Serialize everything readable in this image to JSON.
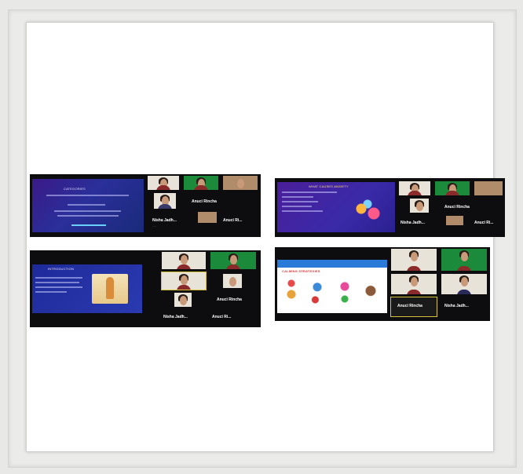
{
  "screenshots": [
    {
      "slide_title": "CATEGORIES",
      "tiles": [
        "",
        "",
        ""
      ],
      "participant_name": "Anuci Rincha",
      "participant_name_2": "Nisha Jadh...",
      "participant_name_3": "Anuci Ri..."
    },
    {
      "slide_title": "WHAT CAUSES ANXIETY",
      "participant_name": "Anuci Rincha",
      "participant_name_2": "Nisha Jadh...",
      "participant_name_3": "Anuci Ri..."
    },
    {
      "slide_title": "INTRODUCTION",
      "participant_name": "Anuci Rincha",
      "participant_name_2": "Nisha Jadh...",
      "participant_name_3": "Anuci Ri..."
    },
    {
      "slide_title": "CALMING STRATEGIES",
      "participant_name": "Anuci Rincha",
      "participant_name_2": "Nisha Jadh..."
    }
  ],
  "colors": {
    "slide": "#2a2f9a",
    "highlight": "#d6c13a",
    "frame": "#ebebe9",
    "paper": "#ffffff"
  }
}
